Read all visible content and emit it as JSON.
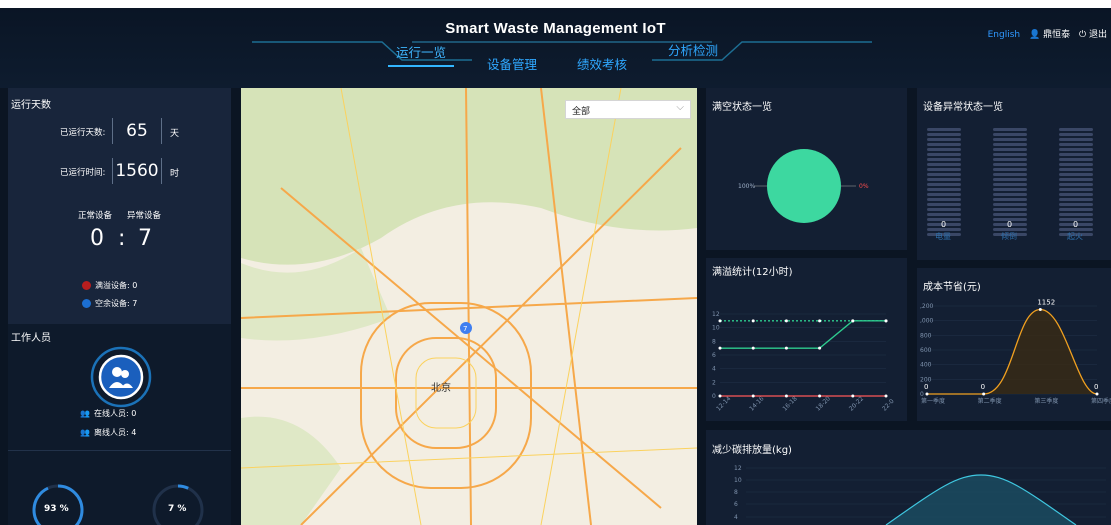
{
  "header": {
    "title": "Smart Waste Management IoT",
    "nav": [
      "运行一览",
      "设备管理",
      "绩效考核",
      "分析检测"
    ],
    "lang": "English",
    "user": "鼎恒泰",
    "logout": "退出"
  },
  "run": {
    "title": "运行天数",
    "days_label": "已运行天数:",
    "days": "65",
    "days_unit": "天",
    "time_label": "已运行时间:",
    "time": "1560",
    "time_unit": "时"
  },
  "device": {
    "normal_label": "正常设备",
    "abnormal_label": "异常设备",
    "normal": "0",
    "sep": ":",
    "abnormal": "7",
    "overflow": "满溢设备: 0",
    "empty": "空余设备: 7"
  },
  "staff": {
    "title": "工作人员",
    "online": "在线人员: 0",
    "offline": "离线人员: 4"
  },
  "rings": {
    "a": "93 %",
    "b": "7 %",
    "a_value": 0.93,
    "b_value": 0.07
  },
  "map": {
    "select": "全部",
    "center_label": "北京",
    "marker": "7"
  },
  "full_state": {
    "title": "满空状态一览",
    "left_label": "100%",
    "right_label": "0%"
  },
  "abnormal": {
    "title": "设备异常状态一览",
    "bars": [
      {
        "value": "0",
        "label": "电量"
      },
      {
        "value": "0",
        "label": "倾倒"
      },
      {
        "value": "0",
        "label": "起火"
      }
    ]
  },
  "overflow_stats": {
    "title": "满溢统计(12小时)",
    "yticks": [
      "0",
      "2",
      "4",
      "6",
      "8",
      "10",
      "12"
    ],
    "xticks": [
      "12-14",
      "14-16",
      "16-18",
      "18-20",
      "20-22",
      "22-0"
    ]
  },
  "cost": {
    "title": "成本节省(元)",
    "yticks": [
      "0",
      "200",
      "400",
      "600",
      "800",
      ",000",
      ",200"
    ],
    "xticks": [
      "第一季度",
      "第二季度",
      "第三季度",
      "第四季度"
    ],
    "values": [
      "0",
      "0",
      "1152",
      "0"
    ]
  },
  "carbon": {
    "title": "减少碳排放量(kg)",
    "yticks": [
      "4",
      "6",
      "8",
      "10",
      "12"
    ]
  },
  "chart_data": [
    {
      "type": "pie",
      "title": "满空状态一览",
      "slices": [
        {
          "label": "100%",
          "value": 100
        },
        {
          "label": "0%",
          "value": 0
        }
      ]
    },
    {
      "type": "line",
      "title": "满溢统计(12小时)",
      "categories": [
        "12-14",
        "14-16",
        "16-18",
        "18-20",
        "20-22",
        "22-0"
      ],
      "ylim": [
        0,
        12
      ],
      "series": [
        {
          "values": [
            11,
            11,
            11,
            11,
            11,
            11
          ]
        },
        {
          "values": [
            7,
            7,
            7,
            7,
            11,
            11
          ]
        },
        {
          "values": [
            0,
            0,
            0,
            0,
            0,
            0
          ]
        }
      ]
    },
    {
      "type": "area",
      "title": "成本节省(元)",
      "categories": [
        "第一季度",
        "第二季度",
        "第三季度",
        "第四季度"
      ],
      "values": [
        0,
        0,
        1152,
        0
      ],
      "ylim": [
        0,
        1200
      ]
    },
    {
      "type": "bar",
      "title": "设备异常状态一览",
      "categories": [
        "电量",
        "倾倒",
        "起火"
      ],
      "values": [
        0,
        0,
        0
      ]
    }
  ]
}
